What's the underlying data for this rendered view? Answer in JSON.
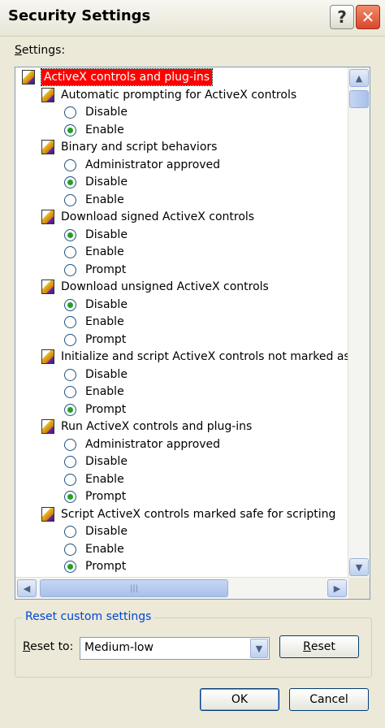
{
  "window": {
    "title": "Security Settings",
    "help_button": "?",
    "close_button": "✕"
  },
  "settings_label_prefix": "S",
  "settings_label_rest": "ettings:",
  "tree": [
    {
      "kind": "root",
      "label": "ActiveX controls and plug-ins"
    },
    {
      "kind": "category",
      "label": "Automatic prompting for ActiveX controls"
    },
    {
      "kind": "option",
      "label": "Disable",
      "checked": false
    },
    {
      "kind": "option",
      "label": "Enable",
      "checked": true
    },
    {
      "kind": "category",
      "label": "Binary and script behaviors"
    },
    {
      "kind": "option",
      "label": "Administrator approved",
      "checked": false
    },
    {
      "kind": "option",
      "label": "Disable",
      "checked": true
    },
    {
      "kind": "option",
      "label": "Enable",
      "checked": false
    },
    {
      "kind": "category",
      "label": "Download signed ActiveX controls"
    },
    {
      "kind": "option",
      "label": "Disable",
      "checked": true
    },
    {
      "kind": "option",
      "label": "Enable",
      "checked": false
    },
    {
      "kind": "option",
      "label": "Prompt",
      "checked": false
    },
    {
      "kind": "category",
      "label": "Download unsigned ActiveX controls"
    },
    {
      "kind": "option",
      "label": "Disable",
      "checked": true
    },
    {
      "kind": "option",
      "label": "Enable",
      "checked": false
    },
    {
      "kind": "option",
      "label": "Prompt",
      "checked": false
    },
    {
      "kind": "category",
      "label": "Initialize and script ActiveX controls not marked as safe"
    },
    {
      "kind": "option",
      "label": "Disable",
      "checked": false
    },
    {
      "kind": "option",
      "label": "Enable",
      "checked": false
    },
    {
      "kind": "option",
      "label": "Prompt",
      "checked": true
    },
    {
      "kind": "category",
      "label": "Run ActiveX controls and plug-ins"
    },
    {
      "kind": "option",
      "label": "Administrator approved",
      "checked": false
    },
    {
      "kind": "option",
      "label": "Disable",
      "checked": false
    },
    {
      "kind": "option",
      "label": "Enable",
      "checked": false
    },
    {
      "kind": "option",
      "label": "Prompt",
      "checked": true
    },
    {
      "kind": "category",
      "label": "Script ActiveX controls marked safe for scripting"
    },
    {
      "kind": "option",
      "label": "Disable",
      "checked": false
    },
    {
      "kind": "option",
      "label": "Enable",
      "checked": false
    },
    {
      "kind": "option",
      "label": "Prompt",
      "checked": true
    }
  ],
  "reset_group": {
    "title": "Reset custom settings",
    "reset_to_prefix": "R",
    "reset_to_rest": "eset to:",
    "selected_level": "Medium-low",
    "reset_prefix": "R",
    "reset_rest": "eset"
  },
  "buttons": {
    "ok": "OK",
    "cancel": "Cancel"
  },
  "colors": {
    "selection": "#ff0000",
    "group_title": "#0046d5",
    "radio_dot": "#21a121"
  }
}
